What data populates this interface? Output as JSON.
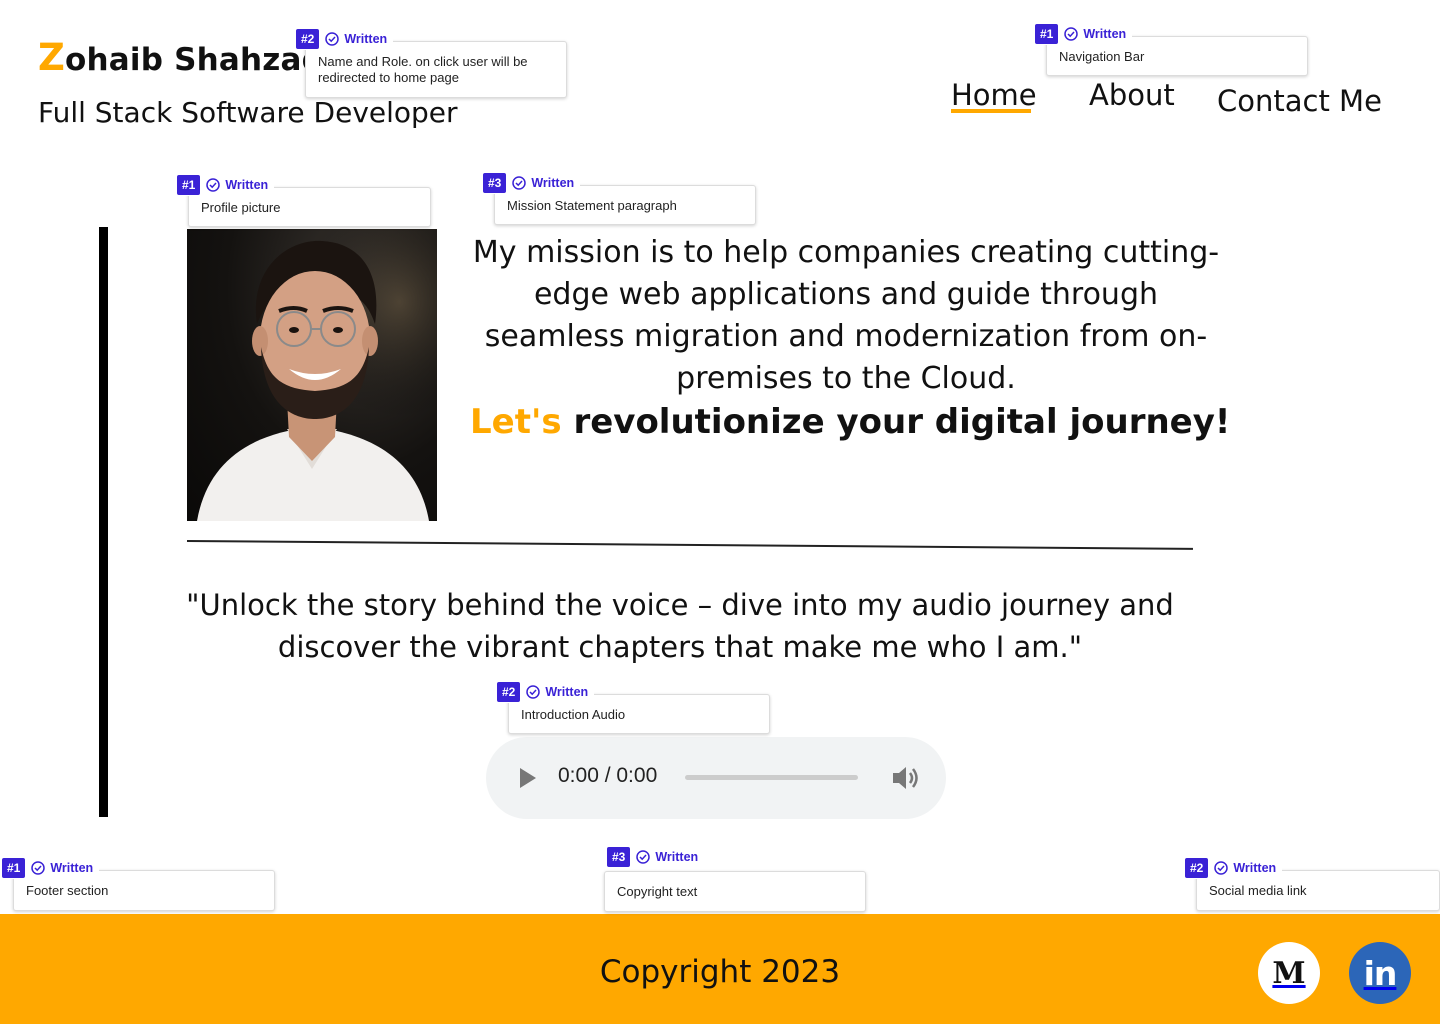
{
  "header": {
    "brand_initial": "Z",
    "brand_rest": "ohaib Shahzad",
    "role": "Full Stack Software Developer"
  },
  "nav": {
    "items": [
      {
        "label": "Home",
        "active": true
      },
      {
        "label": "About"
      },
      {
        "label": "Contact Me"
      }
    ]
  },
  "main": {
    "profile_image": "profile-photo",
    "mission": "My mission is to help companies creating cutting-edge web applications and guide  through seamless migration and modernization from on-premises to the Cloud.",
    "cta_accent": "Let's",
    "cta_rest": " revolutionize your digital journey!",
    "quote": "\"Unlock the story behind the voice – dive into my audio journey and discover the vibrant chapters that make me who I am.\"",
    "audio": {
      "time": "0:00 / 0:00"
    }
  },
  "footer": {
    "copyright": "Copyright 2023",
    "social": [
      {
        "name": "medium-icon",
        "glyph": "M"
      },
      {
        "name": "linkedin-icon",
        "glyph": "in"
      }
    ]
  },
  "notes": [
    {
      "num": "#2",
      "status": "Written",
      "text": "Name and Role. on click user will be redirected to home page"
    },
    {
      "num": "#1",
      "status": "Written",
      "text": "Navigation Bar"
    },
    {
      "num": "#1",
      "status": "Written",
      "text": "Profile picture"
    },
    {
      "num": "#3",
      "status": "Written",
      "text": "Mission Statement paragraph"
    },
    {
      "num": "#2",
      "status": "Written",
      "text": "Introduction Audio"
    },
    {
      "num": "#1",
      "status": "Written",
      "text": "Footer section"
    },
    {
      "num": "#3",
      "status": "Written",
      "text": "Copyright text"
    },
    {
      "num": "#2",
      "status": "Written",
      "text": "Social media link"
    }
  ],
  "colors": {
    "accent": "#FFA800",
    "note_purple": "#3A22D6",
    "linkedin": "#2C66B8"
  }
}
